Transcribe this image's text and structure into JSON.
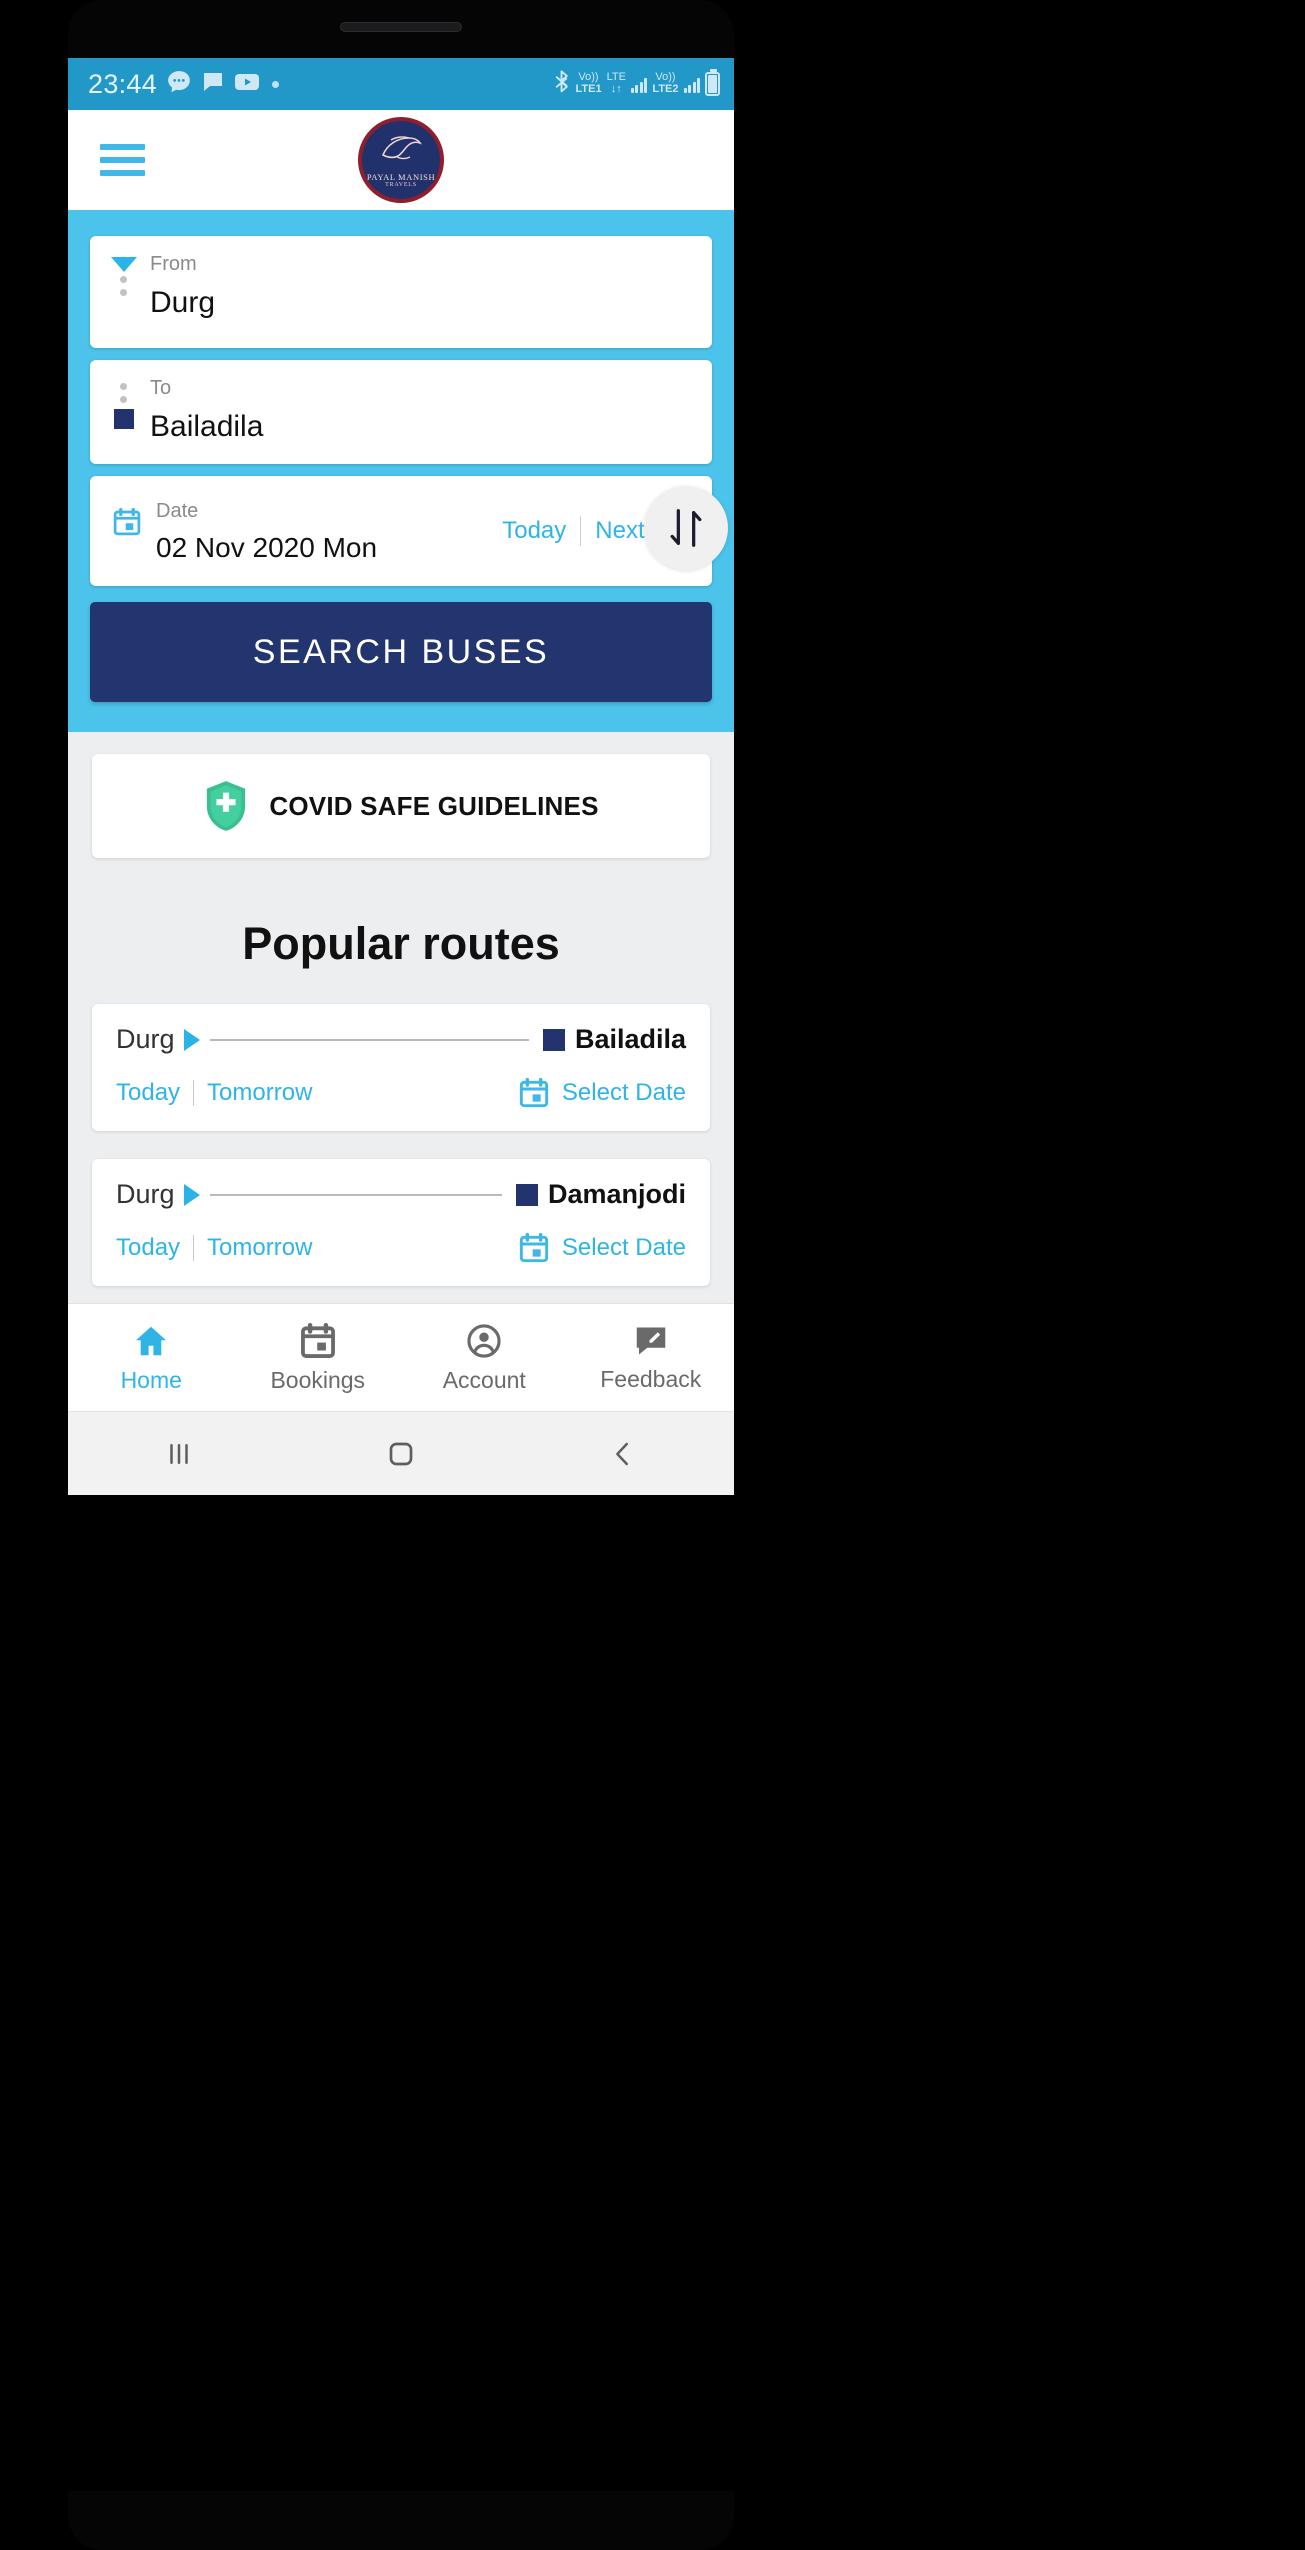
{
  "status_bar": {
    "time": "23:44",
    "left_icons": [
      "messages-bubble-icon",
      "chat-icon",
      "youtube-icon",
      "dot-indicator-icon"
    ],
    "right_icons": [
      "bluetooth-icon",
      "volte1-icon",
      "lte-icon",
      "signal-bars-icon",
      "volte2-icon",
      "signal-bars-2-icon",
      "battery-charging-icon"
    ],
    "volte1_top": "Vo))",
    "volte1_bottom": "LTE1",
    "lte_top": "LTE",
    "lte_bottom": "↓↑",
    "volte2_top": "Vo))",
    "volte2_bottom": "LTE2",
    "bg_color": "#2198c8"
  },
  "header": {
    "menu_icon": "hamburger-menu-icon",
    "logo_name": "PAYAL MANISH",
    "logo_sub": "TRAVELS",
    "logo_bg": "#21316b",
    "logo_ring": "#8f1f2e"
  },
  "search": {
    "from_label": "From",
    "from_value": "Durg",
    "to_label": "To",
    "to_value": "Bailadila",
    "date_label": "Date",
    "date_value": "02 Nov 2020 Mon",
    "today_label": "Today",
    "next_day_label": "Next day",
    "search_button": "SEARCH BUSES",
    "swap_icon": "swap-vertical-icon",
    "panel_bg": "#4cc3ea",
    "button_bg": "#23356e"
  },
  "covid": {
    "label": "COVID SAFE GUIDELINES",
    "icon": "shield-plus-icon",
    "icon_color": "#3bbf8f"
  },
  "popular": {
    "title": "Popular routes",
    "routes": [
      {
        "from": "Durg",
        "to": "Bailadila",
        "today_label": "Today",
        "tomorrow_label": "Tomorrow",
        "select_date_label": "Select Date",
        "calendar_icon": "calendar-icon"
      },
      {
        "from": "Durg",
        "to": "Damanjodi",
        "today_label": "Today",
        "tomorrow_label": "Tomorrow",
        "select_date_label": "Select Date",
        "calendar_icon": "calendar-icon"
      }
    ]
  },
  "bottom_nav": {
    "items": [
      {
        "label": "Home",
        "icon": "home-icon",
        "active": true
      },
      {
        "label": "Bookings",
        "icon": "bookings-calendar-icon",
        "active": false
      },
      {
        "label": "Account",
        "icon": "account-person-icon",
        "active": false
      },
      {
        "label": "Feedback",
        "icon": "feedback-edit-icon",
        "active": false
      }
    ],
    "active_color": "#2fb4e6",
    "inactive_color": "#6a6a6a"
  },
  "system_nav": {
    "recents_icon": "recents-icon",
    "home_icon": "home-square-icon",
    "back_icon": "back-chevron-icon"
  }
}
